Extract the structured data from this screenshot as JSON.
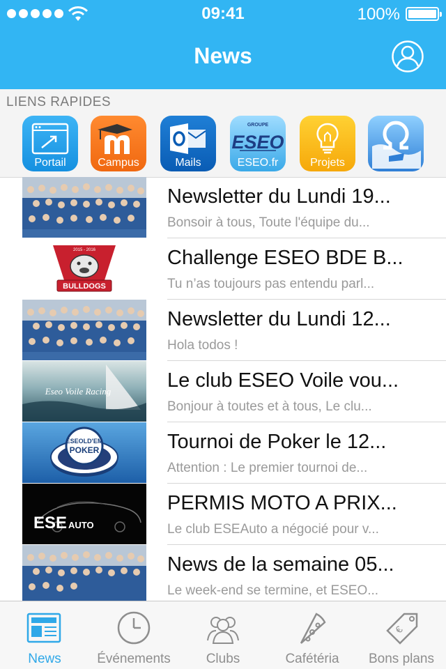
{
  "status_bar": {
    "time": "09:41",
    "battery": "100%",
    "battery_level": 1.0
  },
  "nav": {
    "title": "News"
  },
  "quick_links": {
    "title": "LIENS RAPIDES",
    "items": [
      {
        "label": "Portail",
        "icon": "portal-icon",
        "color": "#1e9ee8"
      },
      {
        "label": "Campus",
        "icon": "moodle-icon",
        "color": "#f7781e"
      },
      {
        "label": "Mails",
        "icon": "outlook-icon",
        "color": "#0c66c2"
      },
      {
        "label": "ESEO.fr",
        "icon": "eseo-logo-icon",
        "color": "#3aa9e8"
      },
      {
        "label": "Projets",
        "icon": "lightbulb-icon",
        "color": "#f9b610"
      },
      {
        "label": "",
        "icon": "omega-icon",
        "color": "#3a8ee0"
      }
    ]
  },
  "feed": [
    {
      "title": "Newsletter du Lundi 19...",
      "subtitle": "Bonsoir à tous, Toute l'équipe du...",
      "thumb": "group-photo"
    },
    {
      "title": "Challenge ESEO BDE B...",
      "subtitle": "Tu n’as toujours pas entendu parl...",
      "thumb": "bulldogs-logo"
    },
    {
      "title": "Newsletter du Lundi 12...",
      "subtitle": "Hola todos !",
      "thumb": "group-photo"
    },
    {
      "title": "Le club ESEO Voile vou...",
      "subtitle": "Bonjour à toutes et à tous, Le clu...",
      "thumb": "voile-photo"
    },
    {
      "title": "Tournoi de Poker le 12...",
      "subtitle": "Attention : Le premier tournoi de...",
      "thumb": "poker-logo"
    },
    {
      "title": "PERMIS MOTO A PRIX...",
      "subtitle": "Le club ESEAuto a négocié pour v...",
      "thumb": "eseauto-logo"
    },
    {
      "title": "News de la semaine 05...",
      "subtitle": "Le week-end se termine, et ESEO...",
      "thumb": "group-photo"
    }
  ],
  "thumb_text": {
    "bulldogs": "BULLDOGS",
    "bulldogs_year": "2015 - 2016",
    "voile": "Eseo Voile Racing",
    "poker_top": "ESEOLD'EM",
    "poker_bottom": "POKER",
    "eseauto": "ESE",
    "eseauto_small": "AUTO"
  },
  "tabs": [
    {
      "label": "News",
      "icon": "newspaper-icon",
      "active": true
    },
    {
      "label": "Événements",
      "icon": "clock-icon",
      "active": false
    },
    {
      "label": "Clubs",
      "icon": "people-icon",
      "active": false
    },
    {
      "label": "Cafétéria",
      "icon": "pizza-icon",
      "active": false
    },
    {
      "label": "Bons plans",
      "icon": "tag-icon",
      "active": false
    }
  ],
  "colors": {
    "accent": "#32b5f3",
    "tab_active": "#2fa8e8",
    "tab_inactive": "#8e8e8e"
  }
}
